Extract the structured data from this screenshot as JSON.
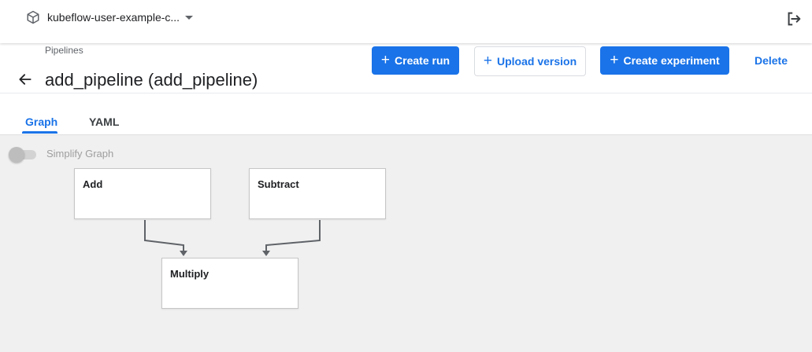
{
  "header": {
    "namespace": "kubeflow-user-example-c...",
    "namespace_icon": "package-cube-icon",
    "logout_icon": "logout-icon"
  },
  "page": {
    "breadcrumb": "Pipelines",
    "title": "add_pipeline (add_pipeline)"
  },
  "actions": {
    "create_run": "Create run",
    "upload_version": "Upload version",
    "create_experiment": "Create experiment",
    "delete": "Delete"
  },
  "tabs": [
    {
      "label": "Graph",
      "active": true
    },
    {
      "label": "YAML",
      "active": false
    }
  ],
  "graph": {
    "simplify_label": "Simplify Graph",
    "simplify_enabled": false,
    "nodes": [
      {
        "id": "add",
        "label": "Add"
      },
      {
        "id": "subtract",
        "label": "Subtract"
      },
      {
        "id": "multiply",
        "label": "Multiply"
      }
    ],
    "edges": [
      {
        "from": "add",
        "to": "multiply"
      },
      {
        "from": "subtract",
        "to": "multiply"
      }
    ]
  },
  "colors": {
    "accent": "#1a73e8",
    "canvas_background": "#f0f0f0",
    "edge": "#5f6368"
  }
}
